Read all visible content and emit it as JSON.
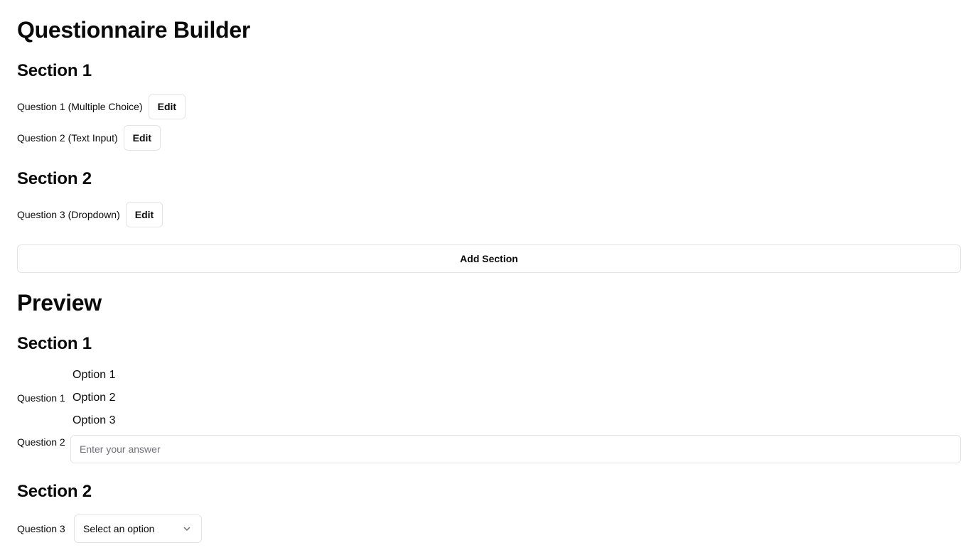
{
  "builder": {
    "title": "Questionnaire Builder",
    "sections": [
      {
        "title": "Section 1",
        "questions": [
          {
            "label": "Question 1 (Multiple Choice)",
            "edit_label": "Edit"
          },
          {
            "label": "Question 2 (Text Input)",
            "edit_label": "Edit"
          }
        ]
      },
      {
        "title": "Section 2",
        "questions": [
          {
            "label": "Question 3 (Dropdown)",
            "edit_label": "Edit"
          }
        ]
      }
    ],
    "add_section_label": "Add Section"
  },
  "preview": {
    "title": "Preview",
    "sections": [
      {
        "title": "Section 1",
        "q1": {
          "label": "Question 1",
          "options": [
            "Option 1",
            "Option 2",
            "Option 3"
          ]
        },
        "q2": {
          "label": "Question 2",
          "placeholder": "Enter your answer",
          "value": ""
        }
      },
      {
        "title": "Section 2",
        "q3": {
          "label": "Question 3",
          "selected": "Select an option",
          "icon": "chevron-down-icon"
        }
      }
    ]
  }
}
